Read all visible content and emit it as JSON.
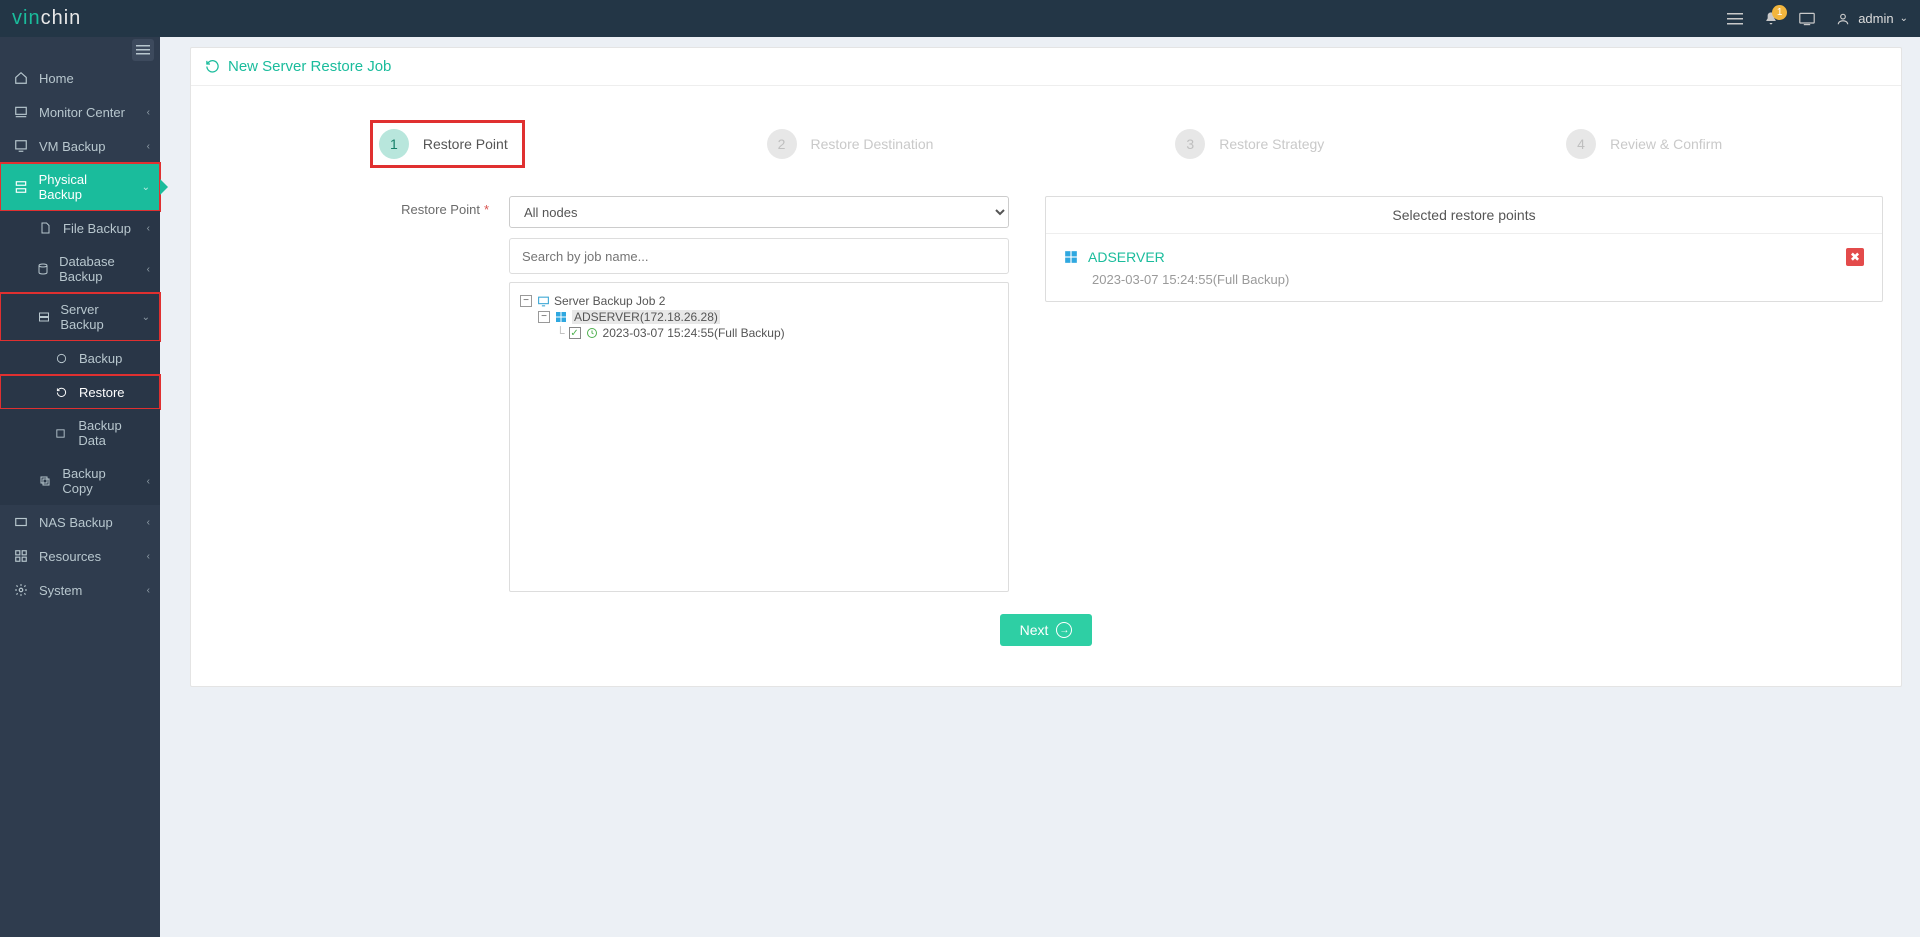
{
  "brand": {
    "part1": "vin",
    "part2": "chin"
  },
  "header": {
    "notification_count": "1",
    "user_label": "admin"
  },
  "sidebar": {
    "items": [
      {
        "label": "Home"
      },
      {
        "label": "Monitor Center"
      },
      {
        "label": "VM Backup"
      },
      {
        "label": "Physical Backup"
      },
      {
        "label": "File Backup"
      },
      {
        "label": "Database Backup"
      },
      {
        "label": "Server Backup"
      },
      {
        "label": "Backup"
      },
      {
        "label": "Restore"
      },
      {
        "label": "Backup Data"
      },
      {
        "label": "Backup Copy"
      },
      {
        "label": "NAS Backup"
      },
      {
        "label": "Resources"
      },
      {
        "label": "System"
      }
    ]
  },
  "page": {
    "title": "New Server Restore Job"
  },
  "steps": [
    {
      "num": "1",
      "label": "Restore Point"
    },
    {
      "num": "2",
      "label": "Restore Destination"
    },
    {
      "num": "3",
      "label": "Restore Strategy"
    },
    {
      "num": "4",
      "label": "Review & Confirm"
    }
  ],
  "form": {
    "restore_point_label": "Restore Point",
    "node_select": "All nodes",
    "search_placeholder": "Search by job name...",
    "tree": {
      "job": "Server Backup Job 2",
      "server_name": "ADSERVER",
      "server_ip": "(172.18.26.28)",
      "point": "2023-03-07 15:24:55(Full  Backup)"
    }
  },
  "selected_panel": {
    "title": "Selected restore points",
    "server": "ADSERVER",
    "point": "2023-03-07 15:24:55(Full Backup)"
  },
  "buttons": {
    "next": "Next"
  }
}
